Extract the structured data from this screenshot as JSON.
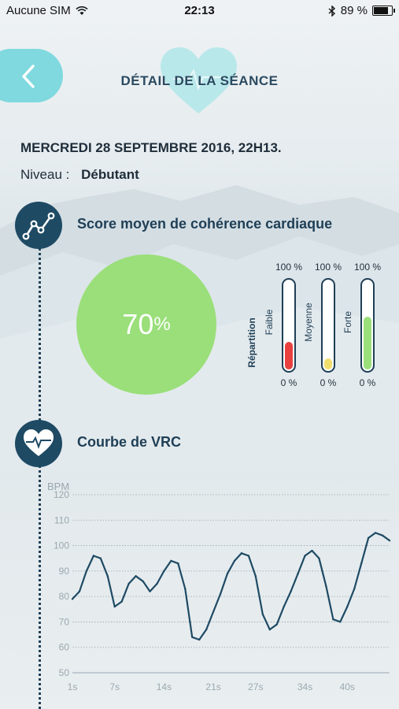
{
  "status_bar": {
    "carrier": "Aucune SIM",
    "time": "22:13",
    "battery": "89 %",
    "battery_level": 0.89
  },
  "header": {
    "title": "DÉTAIL DE LA SÉANCE"
  },
  "session": {
    "date": "MERCREDI 28 SEPTEMBRE 2016, 22H13.",
    "level_label": "Niveau :",
    "level_value": "Débutant"
  },
  "coherence": {
    "title": "Score moyen de cohérence cardiaque",
    "score": "70",
    "score_unit": "%",
    "repartition_label": "Répartition",
    "gauges": [
      {
        "name": "Faible",
        "top": "100 %",
        "bottom": "0 %",
        "level": 0.3,
        "color": "#e8403f"
      },
      {
        "name": "Moyenne",
        "top": "100 %",
        "bottom": "0 %",
        "level": 0.12,
        "color": "#f0df6c"
      },
      {
        "name": "Forte",
        "top": "100 %",
        "bottom": "0 %",
        "level": 0.58,
        "color": "#9adf7a"
      }
    ]
  },
  "vrc": {
    "title": "Courbe de VRC"
  },
  "colors": {
    "accent": "#7fd9df",
    "navy": "#1e4a64",
    "green": "#9adf7a"
  },
  "icons": {
    "back": "chevron-left-icon",
    "heart": "heart-icon",
    "trend": "trend-line-icon",
    "heartbeat": "heartbeat-icon",
    "wifi": "wifi-icon",
    "bluetooth": "bluetooth-icon"
  },
  "chart_data": {
    "type": "line",
    "ylabel": "BPM",
    "xlabel": "",
    "ylim": [
      50,
      120
    ],
    "yticks": [
      50,
      60,
      70,
      80,
      90,
      100,
      110,
      120
    ],
    "xticks": [
      "1s",
      "7s",
      "14s",
      "21s",
      "27s",
      "34s",
      "40s"
    ],
    "xtick_values": [
      1,
      7,
      14,
      21,
      27,
      34,
      40
    ],
    "xlim": [
      1,
      46
    ],
    "grid": true,
    "x": [
      1,
      2,
      3,
      4,
      5,
      6,
      7,
      8,
      9,
      10,
      11,
      12,
      13,
      14,
      15,
      16,
      17,
      18,
      19,
      20,
      21,
      22,
      23,
      24,
      25,
      26,
      27,
      28,
      29,
      30,
      31,
      32,
      33,
      34,
      35,
      36,
      37,
      38,
      39,
      40,
      41,
      42,
      43,
      44,
      45,
      46
    ],
    "y": [
      79,
      82,
      90,
      96,
      95,
      88,
      76,
      78,
      85,
      88,
      86,
      82,
      85,
      90,
      94,
      93,
      83,
      64,
      63,
      67,
      74,
      81,
      89,
      94,
      97,
      96,
      88,
      73,
      67,
      69,
      76,
      82,
      89,
      96,
      98,
      95,
      84,
      71,
      70,
      76,
      83,
      93,
      103,
      105,
      104,
      102
    ]
  }
}
